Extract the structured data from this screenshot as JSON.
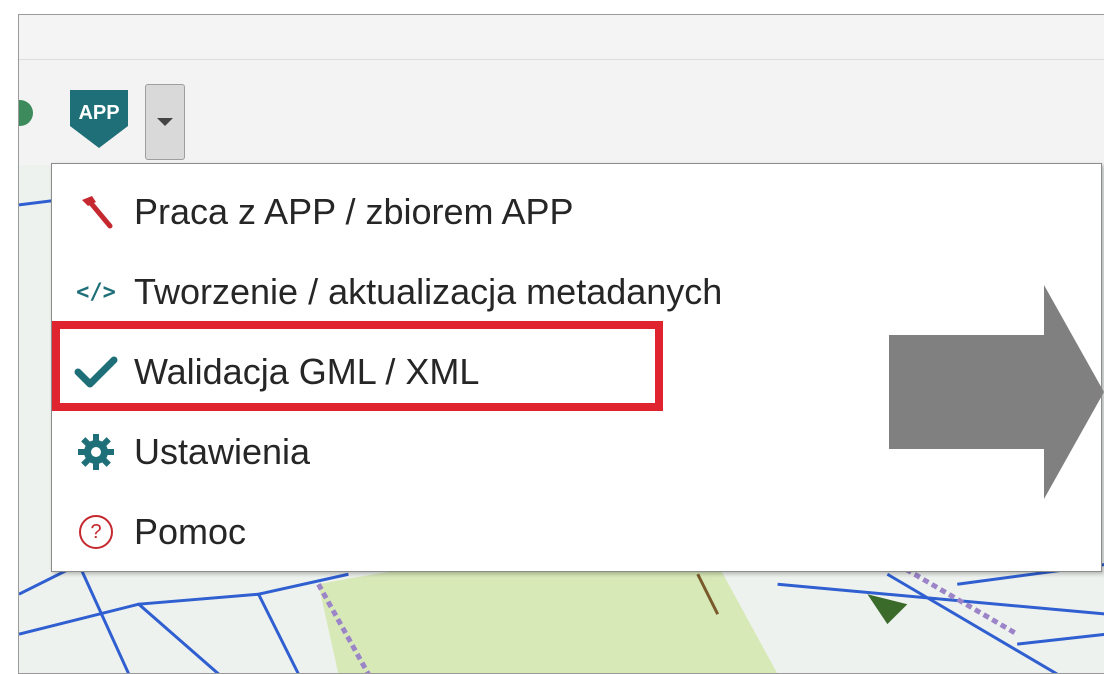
{
  "toolbar": {
    "app_icon_text": "APP",
    "dropdown_icon": "chevron-down-icon"
  },
  "menu": {
    "items": [
      {
        "icon": "hammer-icon",
        "label": "Praca z APP / zbiorem APP"
      },
      {
        "icon": "code-icon",
        "code_symbol": "</>",
        "label": "Tworzenie / aktualizacja metadanych"
      },
      {
        "icon": "checkmark-icon",
        "label": "Walidacja GML / XML",
        "highlighted": true
      },
      {
        "icon": "gear-icon",
        "label": "Ustawienia"
      },
      {
        "icon": "help-icon",
        "symbol": "?",
        "label": "Pomoc"
      }
    ]
  },
  "colors": {
    "highlight": "#e0242f",
    "app_icon": "#1e6f78",
    "check": "#1e6f78",
    "hammer": "#c5282f",
    "arrow": "#808080"
  }
}
